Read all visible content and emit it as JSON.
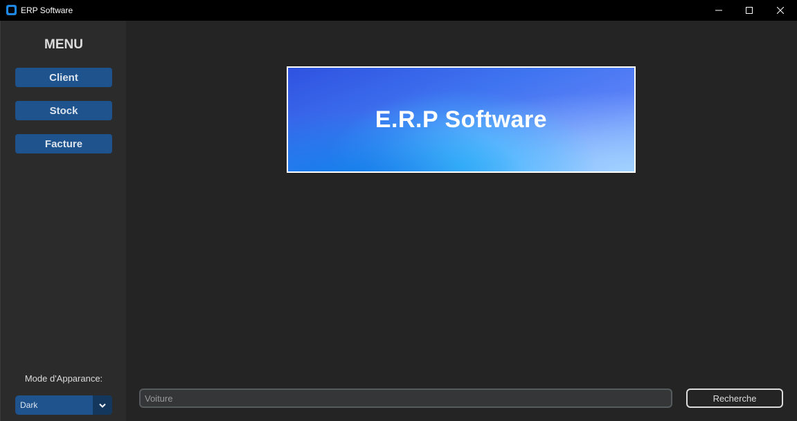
{
  "window": {
    "title": "ERP Software",
    "icon": "app-icon",
    "controls": [
      "minimize-icon",
      "maximize-icon",
      "close-icon"
    ]
  },
  "sidebar": {
    "title": "MENU",
    "buttons": [
      {
        "label": "Client"
      },
      {
        "label": "Stock"
      },
      {
        "label": "Facture"
      }
    ],
    "appearance_label": "Mode d'Apparance:",
    "appearance_value": "Dark"
  },
  "main": {
    "banner_title": "E.R.P Software",
    "search": {
      "value": "",
      "placeholder": "Voiture"
    },
    "search_button": "Recherche"
  },
  "colors": {
    "button": "#1f538d",
    "sidebar_bg": "#2b2b2b",
    "main_bg": "#242424",
    "titlebar_bg": "#000000"
  }
}
